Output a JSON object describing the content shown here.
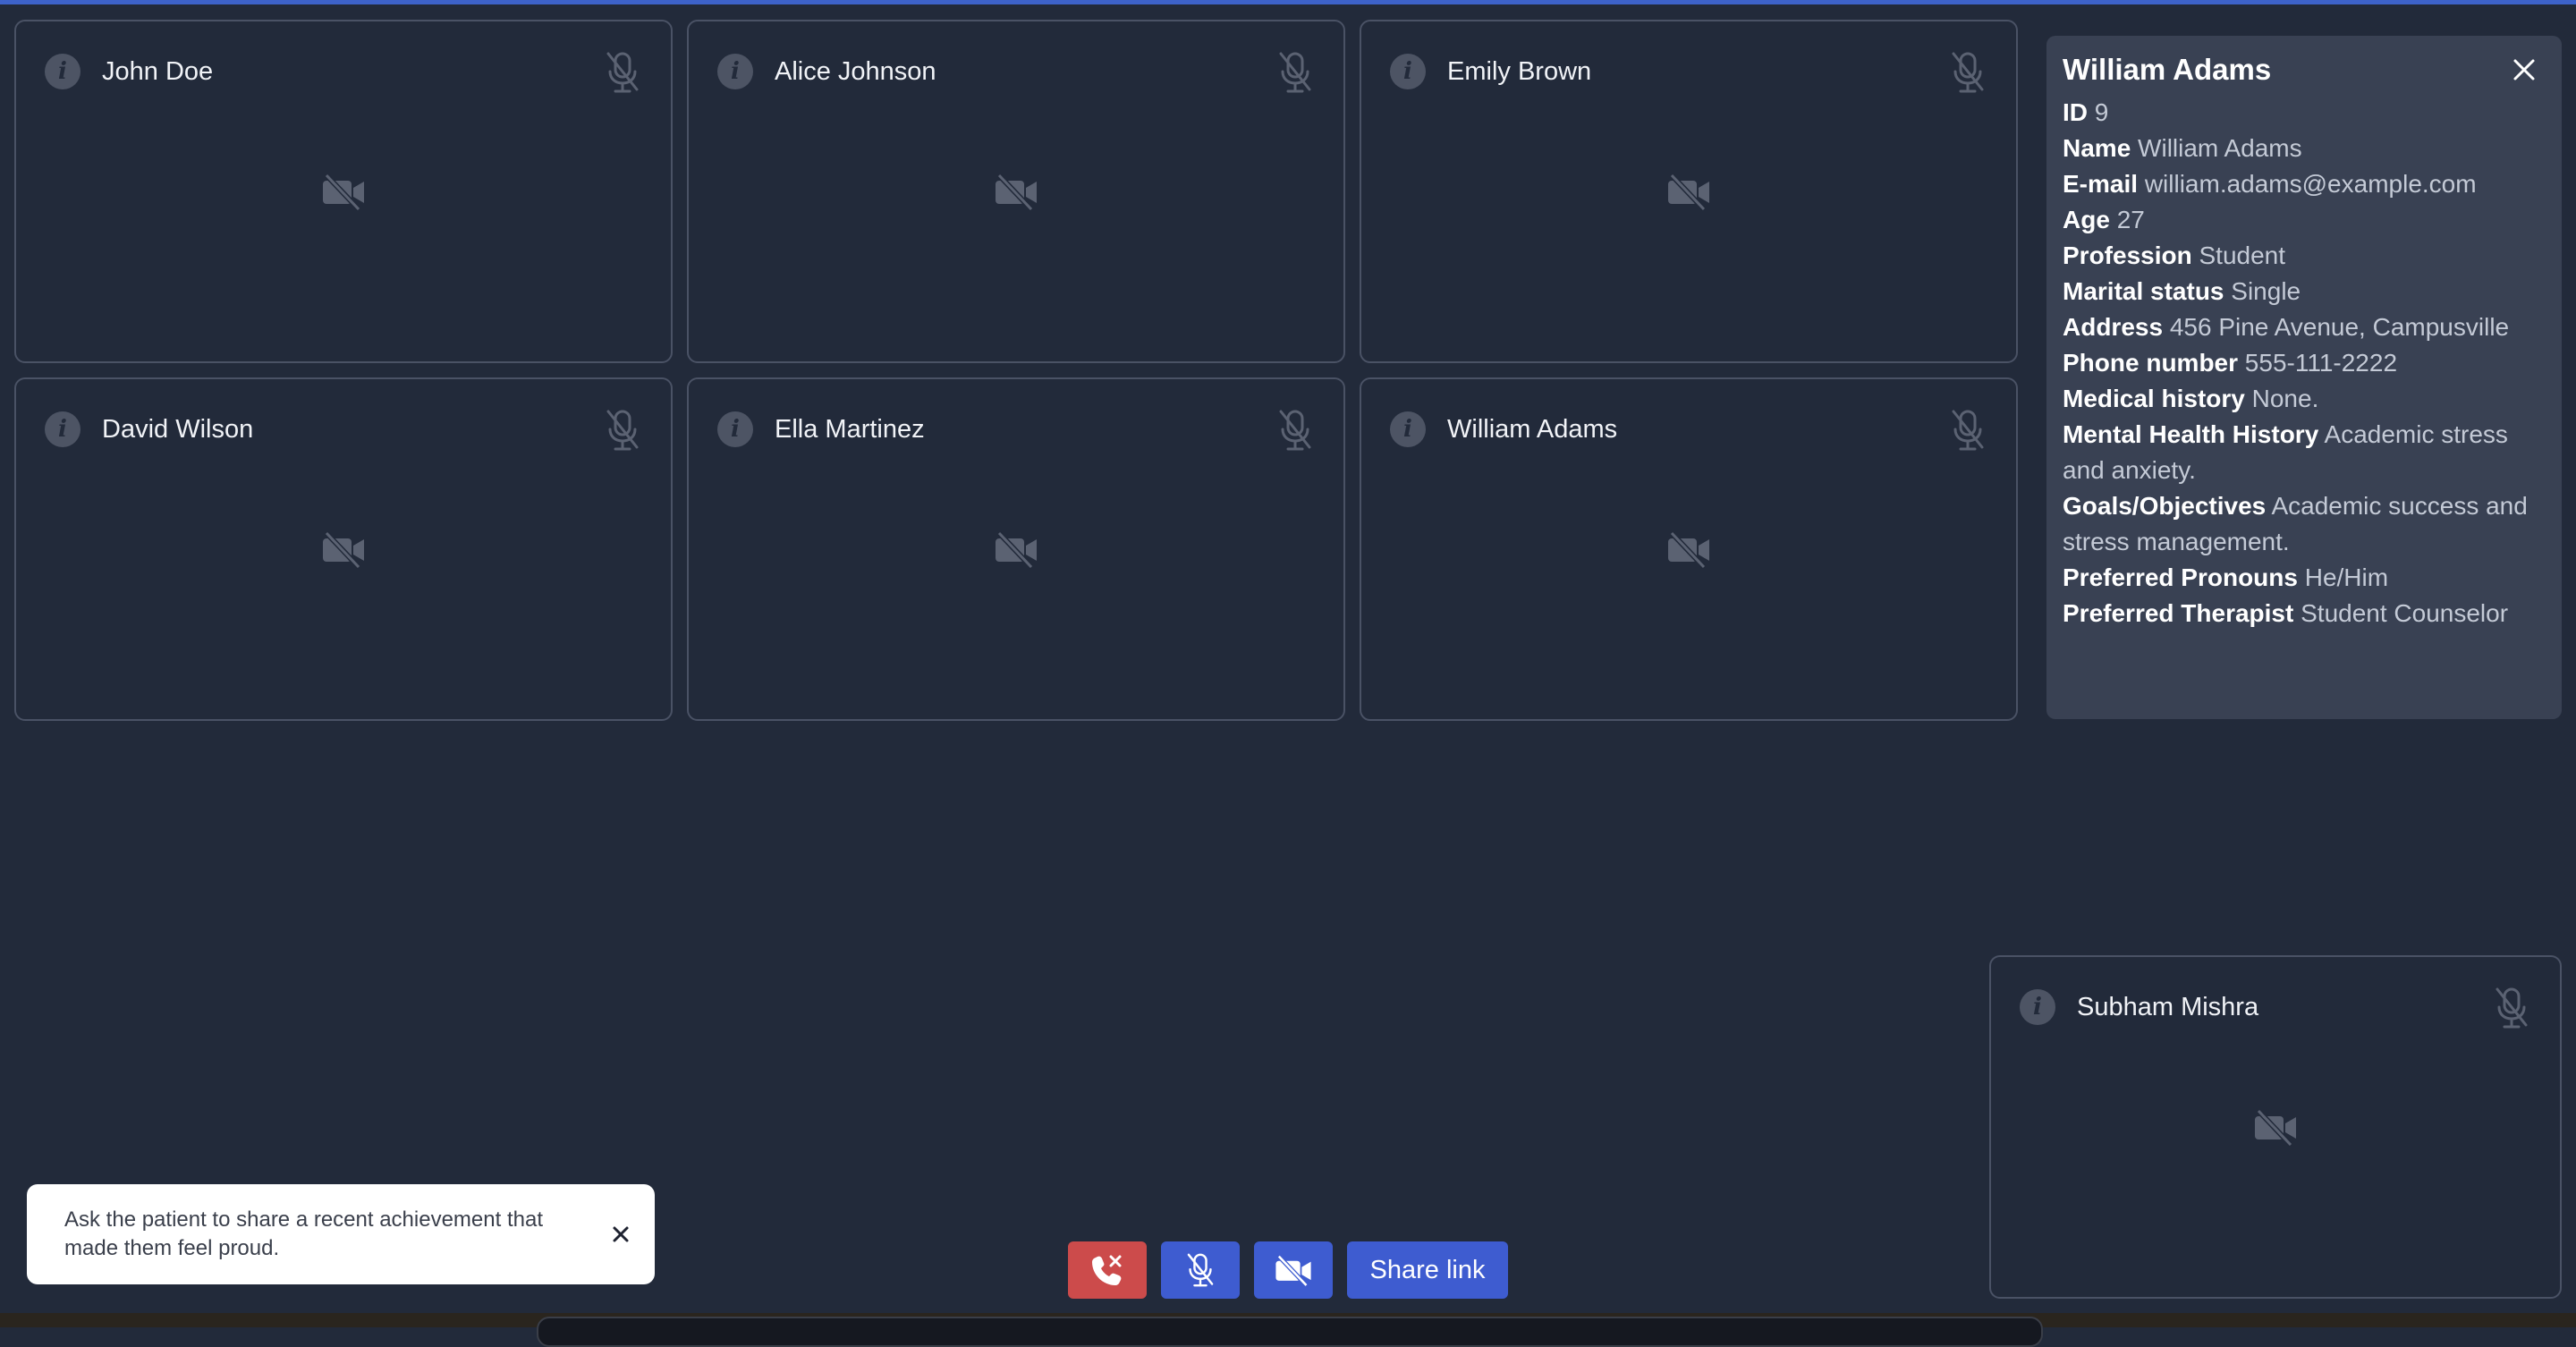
{
  "participants": [
    {
      "name": "John Doe"
    },
    {
      "name": "Alice Johnson"
    },
    {
      "name": "Emily Brown"
    },
    {
      "name": "David Wilson"
    },
    {
      "name": "Ella Martinez"
    },
    {
      "name": "William Adams"
    }
  ],
  "self_view": {
    "name": "Subham Mishra"
  },
  "details_panel": {
    "title": "William Adams",
    "fields": [
      {
        "label": "ID",
        "value": "9"
      },
      {
        "label": "Name",
        "value": "William Adams"
      },
      {
        "label": "E-mail",
        "value": "william.adams@example.com"
      },
      {
        "label": "Age",
        "value": "27"
      },
      {
        "label": "Profession",
        "value": "Student"
      },
      {
        "label": "Marital status",
        "value": "Single"
      },
      {
        "label": "Address",
        "value": "456 Pine Avenue, Campusville"
      },
      {
        "label": "Phone number",
        "value": "555-111-2222"
      },
      {
        "label": "Medical history",
        "value": "None."
      },
      {
        "label": "Mental Health History",
        "value": "Academic stress and anxiety."
      },
      {
        "label": "Goals/Objectives",
        "value": "Academic success and stress management."
      },
      {
        "label": "Preferred Pronouns",
        "value": "He/Him"
      },
      {
        "label": "Preferred Therapist",
        "value": "Student Counselor"
      }
    ]
  },
  "toast": {
    "message": "Ask the patient to share a recent achievement that made them feel proud."
  },
  "controls": {
    "share_label": "Share link"
  },
  "icons": {
    "info": "info-icon",
    "mic_muted": "mic-off-icon",
    "camera_off": "camera-off-icon",
    "close": "close-icon",
    "end_call": "end-call-icon"
  },
  "colors": {
    "background": "#222a3a",
    "panel": "#394153",
    "accent": "#3e5cd0",
    "danger": "#cc4b4b"
  }
}
